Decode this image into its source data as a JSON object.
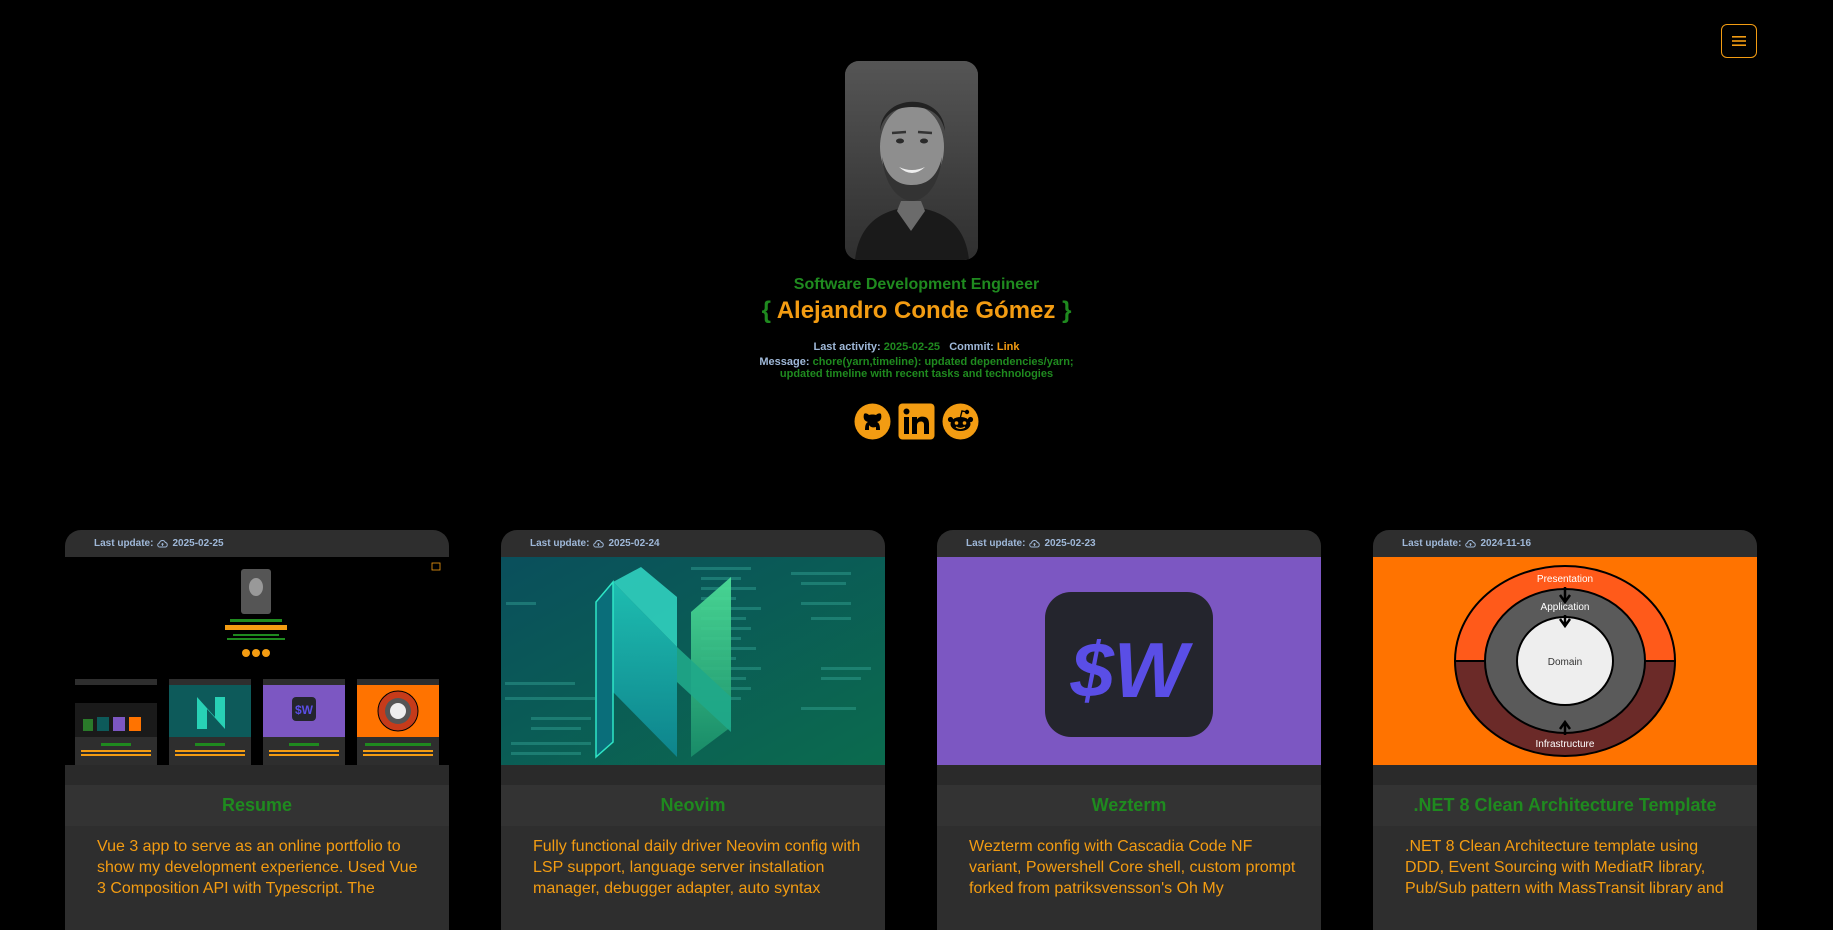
{
  "header": {
    "role": "Software Development Engineer",
    "brace_open": "{",
    "name": "Alejandro Conde Gómez",
    "brace_close": "}"
  },
  "activity": {
    "last_activity_label": "Last activity:",
    "last_activity_date": "2025-02-25",
    "commit_label": "Commit:",
    "commit_link": "Link",
    "message_label": "Message:",
    "message_line1": "chore(yarn,timeline): updated dependencies/yarn;",
    "message_line2": "updated timeline with recent tasks and technologies"
  },
  "socials": [
    {
      "icon": "github-icon"
    },
    {
      "icon": "linkedin-icon"
    },
    {
      "icon": "reddit-icon"
    }
  ],
  "colors": {
    "background": "#000000",
    "accent_orange": "#f39c12",
    "accent_green": "#1f8a1f",
    "label_blue": "#9fb8d8",
    "card_bg": "#2e2e2e"
  },
  "cards": [
    {
      "last_update_label": "Last update:",
      "date": "2025-02-25",
      "title": "Resume",
      "description": "Vue 3 app to serve as an online portfolio to show my development experience. Used Vue 3 Composition API with Typescript. The"
    },
    {
      "last_update_label": "Last update:",
      "date": "2025-02-24",
      "title": "Neovim",
      "description": "Fully functional daily driver Neovim config with LSP support, language server installation manager, debugger adapter, auto syntax"
    },
    {
      "last_update_label": "Last update:",
      "date": "2025-02-23",
      "title": "Wezterm",
      "description": "Wezterm config with Cascadia Code NF variant, Powershell Core shell, custom prompt forked from patriksvensson's Oh My",
      "image_text": "$W"
    },
    {
      "last_update_label": "Last update:",
      "date": "2024-11-16",
      "title": ".NET 8 Clean Architecture Template",
      "description": ".NET 8 Clean Architecture template using DDD, Event Sourcing with MediatR library, Pub/Sub pattern with MassTransit library and",
      "diagram": {
        "outer_top": "Presentation",
        "middle": "Application",
        "center": "Domain",
        "outer_bottom": "Infrastructure"
      }
    }
  ]
}
